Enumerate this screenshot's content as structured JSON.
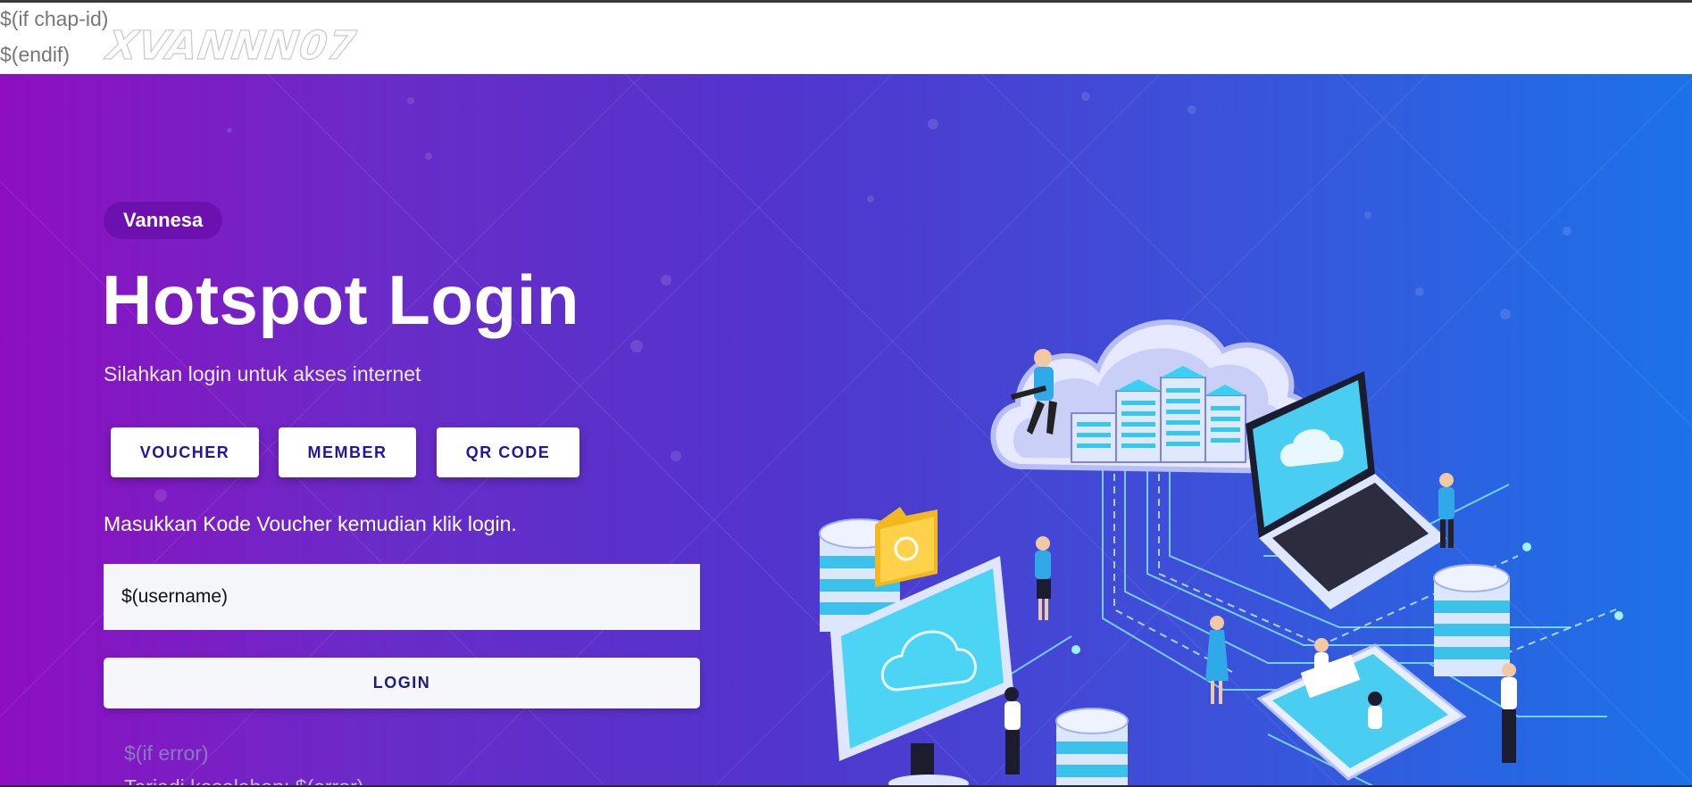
{
  "template": {
    "line1": "$(if chap-id)",
    "line2": "$(endif)",
    "watermark": "XVANNN07"
  },
  "hero": {
    "brand": "Vannesa",
    "title": "Hotspot Login",
    "subtitle": "Silahkan login untuk akses internet",
    "tabs": [
      {
        "label": "VOUCHER"
      },
      {
        "label": "MEMBER"
      },
      {
        "label": "QR CODE"
      }
    ],
    "instruction": "Masukkan Kode Voucher kemudian klik login.",
    "username_value": "$(username)",
    "login_label": "LOGIN",
    "error_open": "$(if error)",
    "error_line": "Terjadi kesalahan: $(error)"
  },
  "colors": {
    "gradient_start": "#8e0fc0",
    "gradient_end": "#1c72e8",
    "tab_text": "#24169a",
    "badge_bg": "#6d10b0"
  },
  "icons": [
    "network-illustration",
    "cloud-server-icon",
    "laptop-icon",
    "monitor-icon",
    "database-icon",
    "folder-sync-icon",
    "phone-icon"
  ]
}
